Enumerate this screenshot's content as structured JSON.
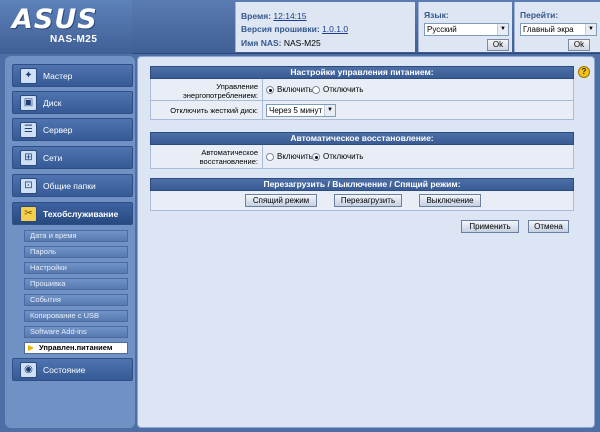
{
  "header": {
    "logo": "ASUS",
    "model": "NAS-M25",
    "time_label": "Время:",
    "time_value": "12:14:15",
    "firmware_label": "Версия прошивки:",
    "firmware_value": "1.0.1.0",
    "nas_name_label": "Имя NAS:",
    "nas_name_value": "NAS-M25",
    "language_label": "Язык:",
    "language_value": "Русский",
    "goto_label": "Перейти:",
    "goto_value": "Главный экра",
    "ok_label": "Ok"
  },
  "sidebar": {
    "items": [
      {
        "label": "Мастер",
        "icon": "wizard-icon"
      },
      {
        "label": "Диск",
        "icon": "disk-icon"
      },
      {
        "label": "Сервер",
        "icon": "server-icon"
      },
      {
        "label": "Сети",
        "icon": "network-icon"
      },
      {
        "label": "Общие папки",
        "icon": "shared-folders-icon"
      },
      {
        "label": "Техобслуживание",
        "icon": "maintenance-icon",
        "active": true
      }
    ],
    "subitems": [
      "Дата и время",
      "Пароль",
      "Настройки",
      "Прошивка",
      "События",
      "Копирование с USB",
      "Software Add-ins",
      "Управлен.питанием"
    ],
    "status_item": {
      "label": "Состояние",
      "icon": "status-icon"
    }
  },
  "power": {
    "title": "Настройки управления питанием:",
    "power_mgmt_label": "Управление энергопотреблением:",
    "enable_label": "Включить",
    "disable_label": "Отключить",
    "power_mgmt_selected": "enable",
    "hdd_label": "Отключить жесткий диск:",
    "hdd_value": "Через 5 минут"
  },
  "recovery": {
    "title": "Автоматическое восстановление:",
    "label": "Автоматическое восстановление:",
    "enable_label": "Включить",
    "disable_label": "Отключить",
    "selected": "disable"
  },
  "reboot": {
    "title": "Перезагрузить / Выключение / Спящий режим:",
    "sleep_label": "Спящий режим",
    "reboot_label": "Перезагрузить",
    "shutdown_label": "Выключение"
  },
  "actions": {
    "apply_label": "Применить",
    "cancel_label": "Отмена"
  }
}
